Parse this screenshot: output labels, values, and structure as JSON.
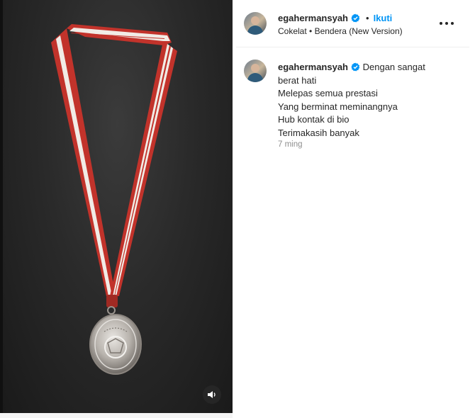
{
  "post": {
    "author": {
      "username": "egahermansyah",
      "verified": true,
      "follow_label": "Ikuti",
      "separator": "•"
    },
    "audio": {
      "track": "Cokelat",
      "separator": " • ",
      "title": "Bendera (New Version)"
    },
    "caption": {
      "username": "egahermansyah",
      "lines": [
        "Dengan sangat",
        "berat hati",
        "Melepas semua prestasi",
        "Yang berminat meminangnya",
        "Hub kontak di bio",
        "Terimakasih banyak"
      ],
      "time": "7 ming"
    },
    "media": {
      "type": "video",
      "description_icon": "medal-image",
      "audio_toggle_icon": "speaker-icon"
    }
  },
  "colors": {
    "follow": "#0095f6",
    "verified": "#0095f6",
    "ribbon_red": "#c2332b",
    "ribbon_white": "#f1ece6"
  }
}
